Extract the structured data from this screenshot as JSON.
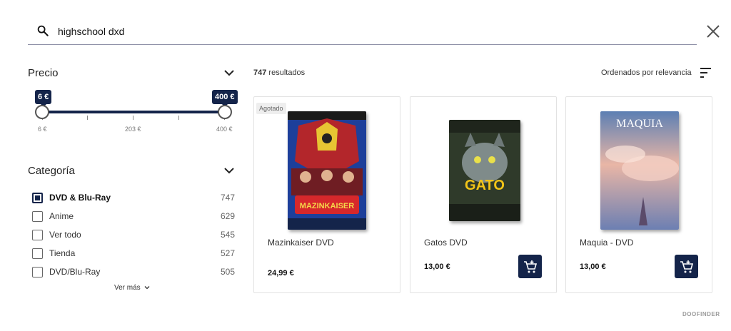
{
  "search": {
    "value": "highschool dxd"
  },
  "filters": {
    "price": {
      "title": "Precio",
      "min_bubble": "6 €",
      "max_bubble": "400 €",
      "ticks": [
        "6 €",
        "203 €",
        "400 €"
      ]
    },
    "category": {
      "title": "Categoría",
      "items": [
        {
          "label": "DVD & Blu-Ray",
          "count": "747",
          "checked": true
        },
        {
          "label": "Anime",
          "count": "629",
          "checked": false
        },
        {
          "label": "Ver todo",
          "count": "545",
          "checked": false
        },
        {
          "label": "Tienda",
          "count": "527",
          "checked": false
        },
        {
          "label": "DVD/Blu-Ray",
          "count": "505",
          "checked": false
        }
      ],
      "see_more": "Ver más"
    }
  },
  "results": {
    "count": "747",
    "count_suffix": "resultados",
    "sort_label": "Ordenados por relevancia"
  },
  "products": [
    {
      "title": "Mazinkaiser DVD",
      "price": "24,99 €",
      "badge": "Agotado",
      "cover_title": "MAZINKAISER"
    },
    {
      "title": "Gatos DVD",
      "price": "13,00 €",
      "cover_title": "GATO"
    },
    {
      "title": "Maquia - DVD",
      "price": "13,00 €",
      "cover_title": "MAQUIA"
    }
  ],
  "brand": "DOOFINDER",
  "colors": {
    "accent": "#14244a"
  }
}
